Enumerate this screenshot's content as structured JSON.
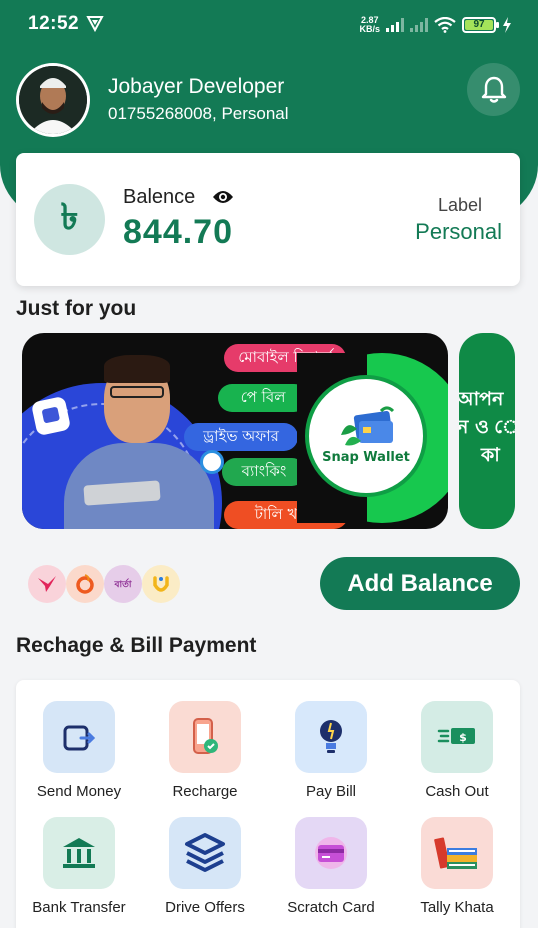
{
  "status_bar": {
    "time": "12:52",
    "net_speed_value": "2.87",
    "net_speed_unit": "KB/s",
    "battery": "97"
  },
  "profile": {
    "name": "Jobayer Developer",
    "subtitle": "01755268008, Personal"
  },
  "balance": {
    "label": "Balence",
    "amount": "844.70",
    "currency_symbol": "৳",
    "type_caption": "Label",
    "type_value": "Personal"
  },
  "just_for_you": {
    "title": "Just for you",
    "banner": {
      "pills": [
        "মোবাইল রিচার্জ",
        "পে বিল",
        "ড্রাইভ অফার",
        "ব্যাংকিং",
        "টালি খাতা"
      ],
      "brand": "Snap Wallet"
    },
    "banner2": {
      "lines": [
        "আপন",
        "ন ও ে",
        "কা"
      ]
    }
  },
  "partners": [
    "bird-logo",
    "ring-logo",
    "barta-logo",
    "u-logo"
  ],
  "partner_text": "বার্তা",
  "add_balance_label": "Add Balance",
  "services": {
    "title": "Rechage & Bill Payment",
    "items": [
      {
        "label": "Send Money",
        "icon": "wallet-icon",
        "bg": "#d6e6f7"
      },
      {
        "label": "Recharge",
        "icon": "phone-recharge-icon",
        "bg": "#fadbd3"
      },
      {
        "label": "Pay Bill",
        "icon": "bulb-icon",
        "bg": "#d7e8fb"
      },
      {
        "label": "Cash Out",
        "icon": "cash-icon",
        "bg": "#d4ece5"
      },
      {
        "label": "Bank Transfer",
        "icon": "bank-icon",
        "bg": "#d9eee6"
      },
      {
        "label": "Drive Offers",
        "icon": "layers-icon",
        "bg": "#d6e6f7"
      },
      {
        "label": "Scratch Card",
        "icon": "card-icon",
        "bg": "#e4d8f5"
      },
      {
        "label": "Tally Khata",
        "icon": "books-icon",
        "bg": "#fadbd6"
      }
    ]
  },
  "colors": {
    "brand_green": "#137a55",
    "background": "#f3f4f6"
  }
}
